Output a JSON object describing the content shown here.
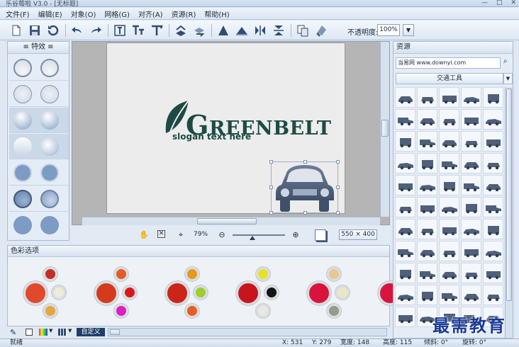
{
  "titlebar": {
    "title": "乐谷莓啦 V3.0 - [无标题]",
    "controls": [
      "—",
      "□",
      "✕"
    ]
  },
  "menu": [
    "文件(F)",
    "编辑(E)",
    "对象(O)",
    "网格(G)",
    "对齐(A)",
    "资源(R)",
    "帮助(H)"
  ],
  "toolbar": {
    "opacity_label": "不透明度:",
    "opacity_value": "100%",
    "dropdown": "▼"
  },
  "effects": {
    "title": "特效"
  },
  "canvas": {
    "logo_initial": "G",
    "logo_rest": "REENBELT",
    "slogan": "slogan text here",
    "zoom_level": "79%",
    "size_label": "550 × 400"
  },
  "colors": {
    "title": "色彩选项",
    "custom_label": "自定义",
    "palettes": [
      {
        "main": "#e1492c",
        "top": "#c62d22",
        "right": "#ecebdc",
        "bottom": "#e5a73f"
      },
      {
        "main": "#d63a1d",
        "top": "#e55b23",
        "right": "#d81818",
        "bottom": "#de1ec0"
      },
      {
        "main": "#cc2418",
        "top": "#e59a1f",
        "right": "#9ccf2f",
        "bottom": "#e55f23"
      },
      {
        "main": "#c8151d",
        "top": "#e7e324",
        "right": "#141414",
        "bottom": "#e8e8e2"
      },
      {
        "main": "#d8143d",
        "top": "#e9c890",
        "right": "#e9e8c3",
        "bottom": "#969c88"
      },
      {
        "main": "#d8143d",
        "top": "#e9c890",
        "right": "#e9e8c3",
        "bottom": "#969c88"
      }
    ]
  },
  "status": {
    "ready": "就绪",
    "x": "X: 531",
    "y": "Y: 279",
    "width": "宽度: 148",
    "height": "高度: 115",
    "skew": "倾斜: 0°",
    "rotate": "旋转: 0°"
  },
  "resources": {
    "title": "资源",
    "site": "当易网 www.downyi.com",
    "category": "交通工具",
    "rows": 11,
    "cols": 5
  },
  "watermark": "最需教育"
}
